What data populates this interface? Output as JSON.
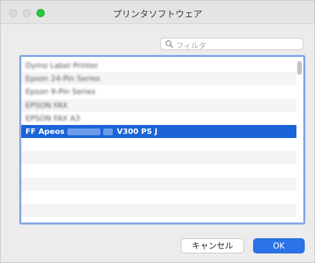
{
  "window": {
    "title": "プリンタソフトウェア"
  },
  "filter": {
    "placeholder": "フィルタ",
    "icon": "search-icon"
  },
  "list": {
    "items": [
      {
        "label": "Dymo Label Printer",
        "blurred": true
      },
      {
        "label": "Epson 24-Pin Series",
        "blurred": true
      },
      {
        "label": "Epson 9-Pin Series",
        "blurred": true
      },
      {
        "label": "EPSON FAX",
        "blurred": true
      },
      {
        "label": "EPSON FAX A3",
        "blurred": true
      },
      {
        "label_prefix": "FF Apeos",
        "label_suffix": "V300 PS J",
        "selected": true
      }
    ],
    "empty_rows": 6
  },
  "buttons": {
    "cancel_label": "キャンセル",
    "ok_label": "OK"
  },
  "colors": {
    "selection": "#1b63d8",
    "focus_ring": "#86a9e6",
    "ok_button": "#2a73e8",
    "zoom_button": "#27c93f"
  }
}
